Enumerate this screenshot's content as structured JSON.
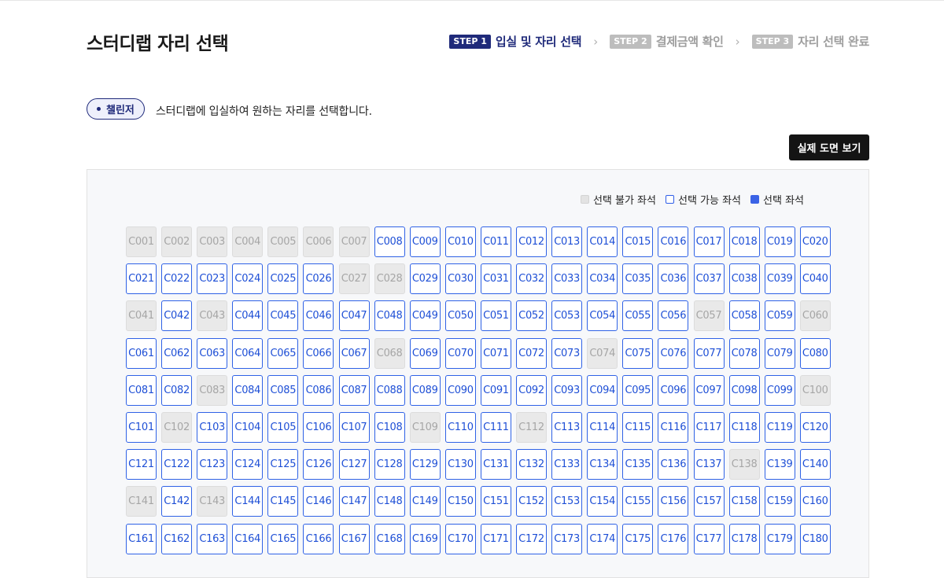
{
  "header": {
    "title": "스터디랩 자리 선택",
    "steps": [
      {
        "badge": "STEP 1",
        "label": "입실 및 자리 선택",
        "active": true
      },
      {
        "badge": "STEP 2",
        "label": "결제금액 확인",
        "active": false
      },
      {
        "badge": "STEP 3",
        "label": "자리 선택 완료",
        "active": false
      }
    ],
    "step_separator": "›"
  },
  "membership": {
    "tier": "챌린저",
    "description": "스터디랩에 입실하여 원하는 자리를 선택합니다."
  },
  "actions": {
    "view_plan_label": "실제 도면 보기"
  },
  "legend": {
    "unavailable": "선택 불가 좌석",
    "available": "선택 가능 좌석",
    "selected": "선택 좌석"
  },
  "colors": {
    "brand_navy": "#1f2a7a",
    "seat_border": "#2f62e6",
    "selected_fill": "#3b63e6",
    "unavailable_fill": "#e9e9e9"
  },
  "seats": {
    "prefix": "C",
    "total": 180,
    "per_row": 20,
    "unavailable": [
      1,
      2,
      3,
      4,
      5,
      6,
      7,
      27,
      28,
      41,
      43,
      57,
      60,
      68,
      74,
      83,
      100,
      102,
      109,
      112,
      138,
      141,
      143
    ],
    "selected": []
  }
}
